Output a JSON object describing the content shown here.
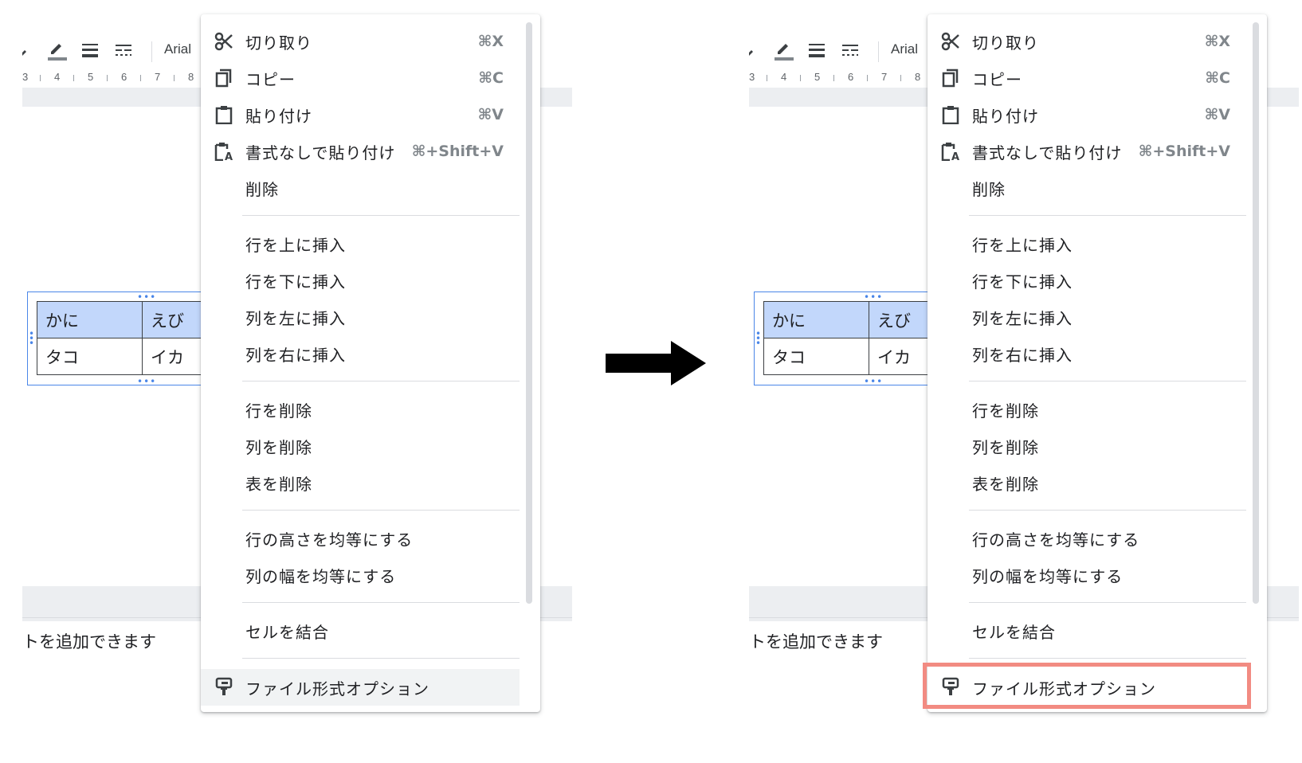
{
  "toolbar": {
    "font": "Arial"
  },
  "ruler": {
    "numbers": [
      "3",
      "4",
      "5",
      "6",
      "7",
      "8"
    ]
  },
  "table": {
    "rows": [
      [
        "かに",
        "えび"
      ],
      [
        "タコ",
        "イカ"
      ]
    ]
  },
  "document": {
    "bottom_text": "トを追加できます"
  },
  "menu": {
    "cut": {
      "label": "切り取り",
      "shortcut": "⌘X"
    },
    "copy": {
      "label": "コピー",
      "shortcut": "⌘C"
    },
    "paste": {
      "label": "貼り付け",
      "shortcut": "⌘V"
    },
    "paste_plain": {
      "label": "書式なしで貼り付け",
      "shortcut": "⌘+Shift+V"
    },
    "delete": {
      "label": "削除"
    },
    "insert_row_above": {
      "label": "行を上に挿入"
    },
    "insert_row_below": {
      "label": "行を下に挿入"
    },
    "insert_col_left": {
      "label": "列を左に挿入"
    },
    "insert_col_right": {
      "label": "列を右に挿入"
    },
    "delete_row": {
      "label": "行を削除"
    },
    "delete_col": {
      "label": "列を削除"
    },
    "delete_table": {
      "label": "表を削除"
    },
    "distribute_rows": {
      "label": "行の高さを均等にする"
    },
    "distribute_cols": {
      "label": "列の幅を均等にする"
    },
    "merge_cells": {
      "label": "セルを結合"
    },
    "format_options": {
      "label": "ファイル形式オプション"
    }
  },
  "colors": {
    "highlight": "#f28b82",
    "table_header": "#c2d7fb",
    "selection": "#4a86e8"
  }
}
